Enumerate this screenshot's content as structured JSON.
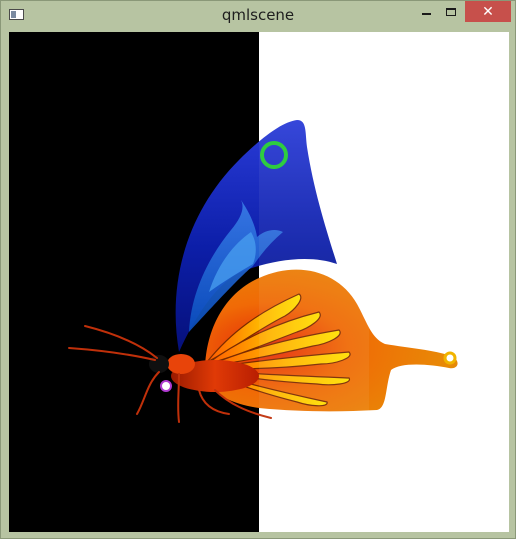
{
  "window": {
    "title": "qmlscene",
    "controls": {
      "minimize": "minimize",
      "maximize": "maximize",
      "close": "close"
    }
  },
  "scene": {
    "left_background": "#000000",
    "right_background": "#ffffff",
    "subject": "butterfly-icon"
  },
  "colors": {
    "titlebar": "#b7c4a2",
    "close_button": "#c7504b",
    "ring_green": "#2ecc40"
  }
}
